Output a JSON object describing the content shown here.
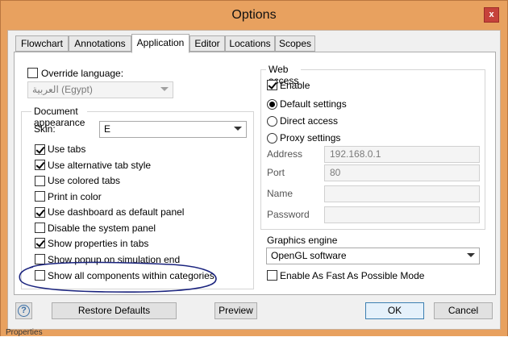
{
  "window": {
    "title": "Options",
    "close_glyph": "x"
  },
  "tabs": [
    {
      "label": "Flowchart"
    },
    {
      "label": "Annotations"
    },
    {
      "label": "Application"
    },
    {
      "label": "Editor"
    },
    {
      "label": "Locations"
    },
    {
      "label": "Scopes"
    }
  ],
  "active_tab": "Application",
  "language": {
    "override_label": "Override language:",
    "override_checked": false,
    "selected": "العربية (Egypt)"
  },
  "appearance": {
    "group_title": "Document appearance",
    "skin_label": "Skin:",
    "skin_value": "E",
    "options": [
      {
        "label": "Use tabs",
        "checked": true
      },
      {
        "label": "Use alternative tab style",
        "checked": true
      },
      {
        "label": "Use colored tabs",
        "checked": false
      },
      {
        "label": "Print in color",
        "checked": false
      },
      {
        "label": "Use dashboard as default panel",
        "checked": true
      },
      {
        "label": "Disable the system panel",
        "checked": false
      },
      {
        "label": "Show properties in tabs",
        "checked": true
      },
      {
        "label": "Show popup on simulation end",
        "checked": false
      },
      {
        "label": "Show all components within categories",
        "checked": false
      }
    ]
  },
  "web_access": {
    "group_title": "Web access",
    "enable_label": "Enable",
    "enable_checked": true,
    "modes": [
      {
        "label": "Default settings",
        "selected": true
      },
      {
        "label": "Direct access",
        "selected": false
      },
      {
        "label": "Proxy settings",
        "selected": false
      }
    ],
    "address_label": "Address",
    "address_value": "192.168.0.1",
    "port_label": "Port",
    "port_value": "80",
    "name_label": "Name",
    "name_value": "",
    "password_label": "Password",
    "password_value": ""
  },
  "graphics": {
    "label": "Graphics engine",
    "value": "OpenGL software",
    "fast_mode_label": "Enable As Fast As Possible Mode",
    "fast_mode_checked": false
  },
  "buttons": {
    "help": "?",
    "restore": "Restore Defaults",
    "preview": "Preview",
    "ok": "OK",
    "cancel": "Cancel"
  },
  "colors": {
    "frame": "#e8a15f",
    "annotation_ink": "#1a237e"
  },
  "bottom_text": "Properties"
}
